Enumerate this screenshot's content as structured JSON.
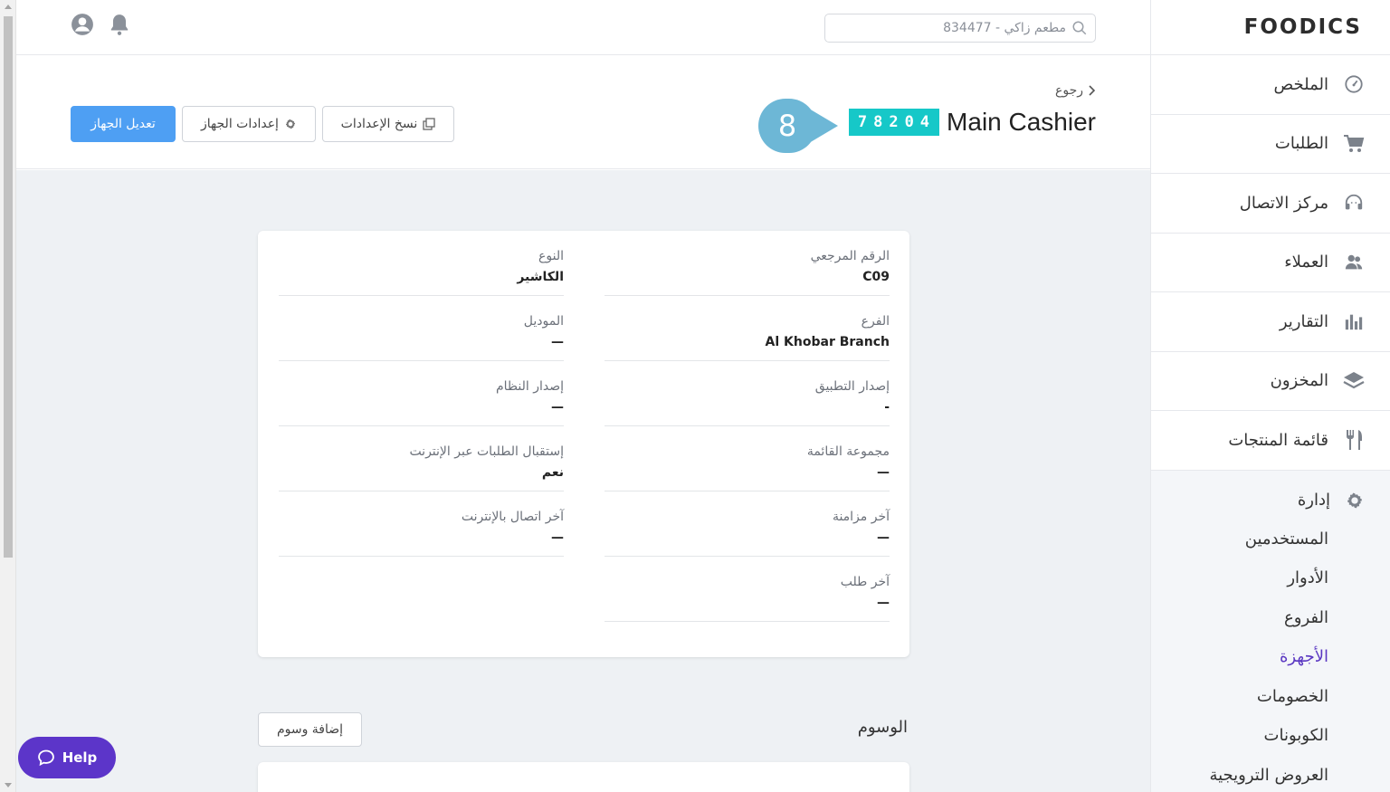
{
  "brand": {
    "logo_text": "FOODICS"
  },
  "topbar": {
    "search_placeholder": "مطعم زاكي - 834477"
  },
  "sidebar": {
    "items": [
      {
        "label": "الملخص",
        "icon": "dashboard-gauge-icon"
      },
      {
        "label": "الطلبات",
        "icon": "cart-icon"
      },
      {
        "label": "مركز الاتصال",
        "icon": "headset-icon"
      },
      {
        "label": "العملاء",
        "icon": "users-icon"
      },
      {
        "label": "التقارير",
        "icon": "bar-chart-icon"
      },
      {
        "label": "المخزون",
        "icon": "layers-icon"
      },
      {
        "label": "قائمة المنتجات",
        "icon": "utensils-icon"
      }
    ],
    "admin": {
      "label": "إدارة",
      "icon": "gear-icon",
      "subitems": [
        "المستخدمين",
        "الأدوار",
        "الفروع",
        "الأجهزة",
        "الخصومات",
        "الكوبونات",
        "العروض الترويجية"
      ],
      "active": "الأجهزة"
    }
  },
  "header": {
    "back_label": "رجوع",
    "title": "Main Cashier",
    "code": "78204",
    "step_number": "8",
    "buttons": {
      "copy_settings": "نسخ الإعدادات",
      "device_settings": "إعدادات الجهاز",
      "edit_device": "تعديل الجهاز"
    }
  },
  "details": {
    "fields": [
      {
        "label": "الرقم المرجعي",
        "value": "C09"
      },
      {
        "label": "النوع",
        "value": "الكاشير"
      },
      {
        "label": "الفرع",
        "value": "Al Khobar Branch"
      },
      {
        "label": "الموديل",
        "value": "—"
      },
      {
        "label": "إصدار التطبيق",
        "value": "-"
      },
      {
        "label": "إصدار النظام",
        "value": "—"
      },
      {
        "label": "مجموعة القائمة",
        "value": "—"
      },
      {
        "label": "إستقبال الطلبات عبر الإنترنت",
        "value": "نعم"
      },
      {
        "label": "آخر مزامنة",
        "value": "—"
      },
      {
        "label": "آخر اتصال بالإنترنت",
        "value": "—"
      },
      {
        "label": "آخر طلب",
        "value": "—"
      }
    ]
  },
  "tags": {
    "title": "الوسوم",
    "add_label": "إضافة وسوم"
  },
  "help": {
    "label": "Help"
  },
  "colors": {
    "accent": "#5a37c2",
    "primary_button": "#4e9ff3",
    "code_badge": "#16c8c8",
    "tooltip": "#6db7d6",
    "help_button": "#5c35c9"
  }
}
